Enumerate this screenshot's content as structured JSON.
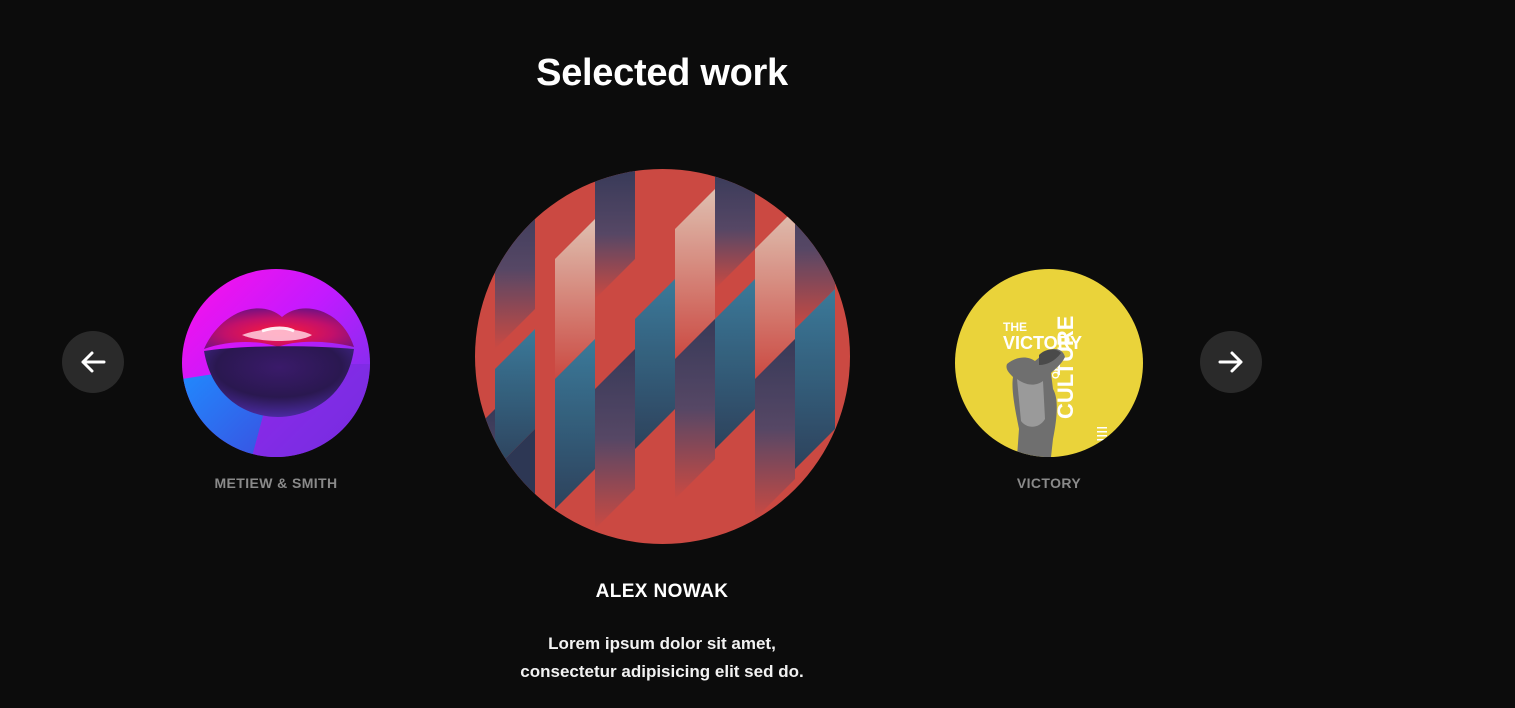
{
  "section": {
    "title": "Selected work"
  },
  "navigation": {
    "prev_icon": "arrow-left-icon",
    "next_icon": "arrow-right-icon"
  },
  "slides": {
    "previous": {
      "name": "METIEW & SMITH",
      "image": "neon-lips-artwork"
    },
    "current": {
      "name": "ALEX NOWAK",
      "image": "red-geometric-pattern-artwork",
      "description_line1": "Lorem ipsum dolor sit amet,",
      "description_line2": "consectetur adipisicing elit sed do."
    },
    "next": {
      "name": "VICTORY",
      "image": "victory-of-culture-poster",
      "poster_text": "THE VICTORY OF CULTURE"
    }
  },
  "colors": {
    "background": "#0c0c0c",
    "nav_button": "#2a2a2a",
    "side_caption": "#8a8a8a",
    "pattern_red": "#d44d45",
    "pattern_blue": "#3e7fa0",
    "poster_yellow": "#ead33a"
  }
}
